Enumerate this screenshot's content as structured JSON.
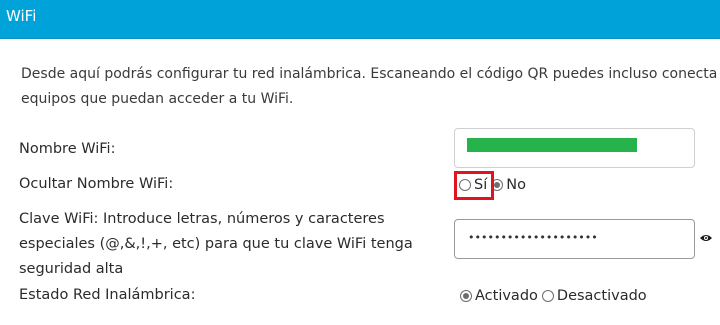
{
  "header": {
    "title": "WiFi"
  },
  "description": {
    "line1": "Desde aquí podrás configurar tu red inalámbrica. Escaneando el código QR puedes incluso conecta",
    "line2": "equipos que puedan acceder a tu WiFi."
  },
  "fields": {
    "ssid": {
      "label": "Nombre WiFi:",
      "value_redacted": true
    },
    "hide_ssid": {
      "label": "Ocultar Nombre WiFi:",
      "options": [
        "Sí",
        "No"
      ],
      "selected": "No"
    },
    "password": {
      "label_line1": "Clave WiFi: Introduce letras, números y caracteres",
      "label_line2": "especiales (@,&,!,+, etc) para que tu clave WiFi tenga",
      "label_line3": "seguridad alta",
      "masked_value": "••••••••••••••••••••",
      "reveal_icon": "eye-icon"
    },
    "wireless_state": {
      "label": "Estado Red Inalámbrica:",
      "options": [
        "Activado",
        "Desactivado"
      ],
      "selected": "Activado"
    }
  },
  "colors": {
    "header_bg": "#00a3d9",
    "redaction": "#27b34b",
    "highlight_border": "#e0141e"
  }
}
